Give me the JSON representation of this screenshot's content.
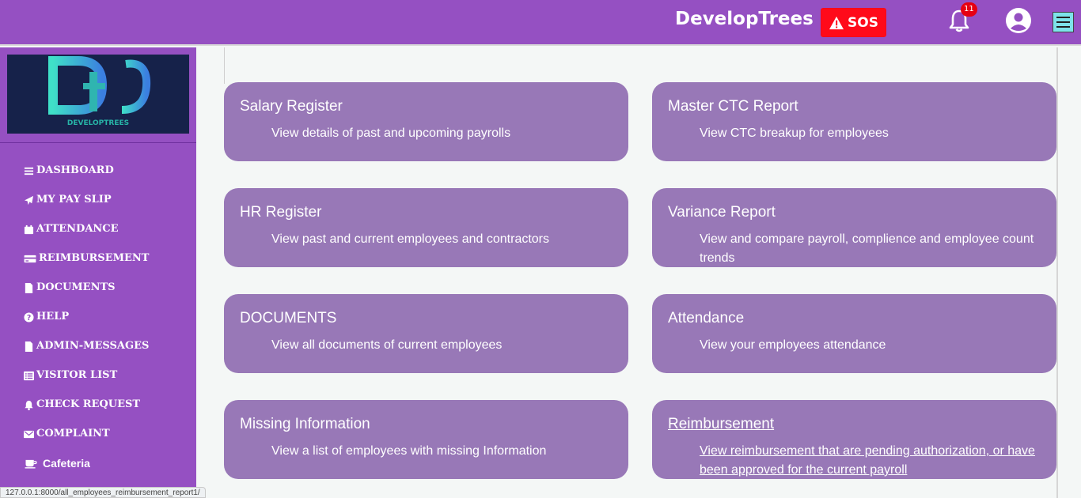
{
  "header": {
    "brand": "DevelopTrees",
    "sos_label": "SOS",
    "notification_count": "11"
  },
  "sidebar": {
    "logo_text": "DEVELOPTREES",
    "items": [
      {
        "label": "DASHBOARD",
        "icon": "bars-icon"
      },
      {
        "label": "MY PAY SLIP",
        "icon": "paper-plane-icon"
      },
      {
        "label": "ATTENDANCE",
        "icon": "calendar-icon"
      },
      {
        "label": "REIMBURSEMENT",
        "icon": "credit-card-icon"
      },
      {
        "label": "DOCUMENTS",
        "icon": "file-icon"
      },
      {
        "label": "HELP",
        "icon": "question-circle-icon"
      },
      {
        "label": "ADMIN-MESSAGES",
        "icon": "file-icon"
      },
      {
        "label": "VISITOR LIST",
        "icon": "list-icon"
      },
      {
        "label": "CHECK REQUEST",
        "icon": "bell-icon"
      },
      {
        "label": "COMPLAINT",
        "icon": "envelope-icon"
      },
      {
        "label": "Cafeteria",
        "icon": "coffee-icon"
      }
    ]
  },
  "cards": [
    {
      "title": "Salary Register",
      "desc": "View details of past and upcoming payrolls"
    },
    {
      "title": "Master CTC Report",
      "desc": "View CTC breakup for employees"
    },
    {
      "title": "HR Register",
      "desc": "View past and current employees and contractors"
    },
    {
      "title": "Variance Report",
      "desc": "View and compare payroll, complience and employee count trends"
    },
    {
      "title": "DOCUMENTS",
      "desc": "View all documents of current employees"
    },
    {
      "title": "Attendance",
      "desc": "View your employees attendance"
    },
    {
      "title": "Missing Information",
      "desc": "View a list of employees with missing Information"
    },
    {
      "title": "Reimbursement",
      "desc": "View reimbursement that are pending authorization, or have been approved for the current payroll"
    }
  ],
  "status_url": "127.0.0.1:8000/all_employees_reimbursement_report1/",
  "colors": {
    "primary": "#9550c2",
    "card": "#9878b7",
    "sos": "#ff0a1a",
    "menu_button": "#7de3ea"
  }
}
